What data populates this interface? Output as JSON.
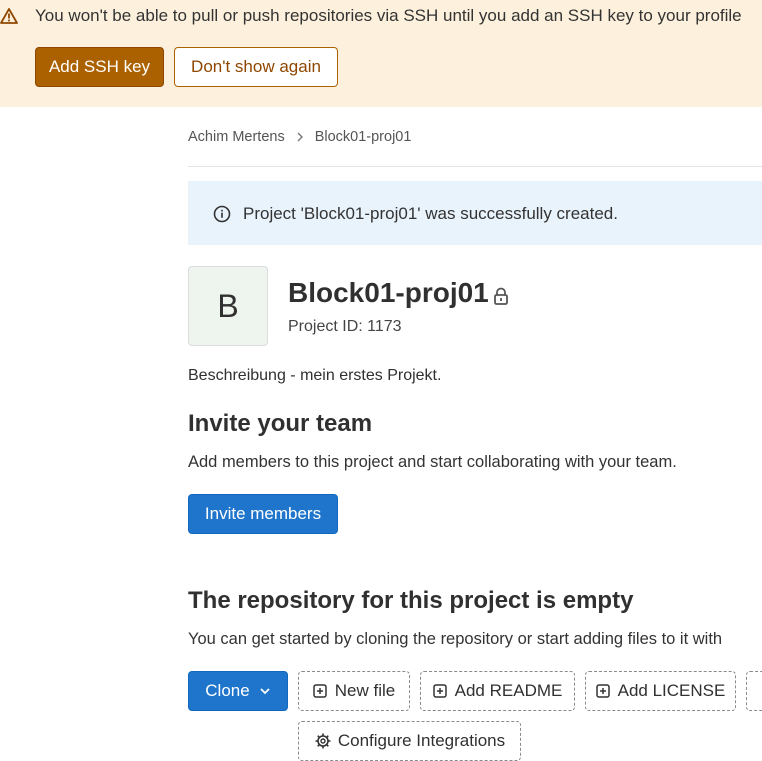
{
  "banner": {
    "warning_icon": "warning-icon",
    "message": "You won't be able to pull or push repositories via SSH until you add an SSH key to your profile",
    "add_ssh_key_label": "Add SSH key",
    "dont_show_again_label": "Don't show again",
    "colors": {
      "background": "#fdf1dd",
      "primary": "#ab6100"
    }
  },
  "breadcrumb": {
    "items": [
      "Achim Mertens",
      "Block01-proj01"
    ],
    "separator_icon": "chevron-right-icon"
  },
  "alert": {
    "icon": "info-icon",
    "message": "Project 'Block01-proj01' was successfully created."
  },
  "project": {
    "avatar_letter": "B",
    "name": "Block01-proj01",
    "visibility_icon": "lock-icon",
    "id_label": "Project ID: 1173",
    "description": "Beschreibung - mein erstes Projekt."
  },
  "invite": {
    "heading": "Invite your team",
    "text": "Add members to this project and start collaborating with your team.",
    "button_label": "Invite members"
  },
  "repository": {
    "heading": "The repository for this project is empty",
    "text": "You can get started by cloning the repository or start adding files to it with",
    "clone_label": "Clone",
    "new_file_label": "New file",
    "add_readme_label": "Add README",
    "add_license_label": "Add LICENSE",
    "configure_integrations_label": "Configure Integrations",
    "colors": {
      "primary_button": "#1f75cb"
    }
  }
}
